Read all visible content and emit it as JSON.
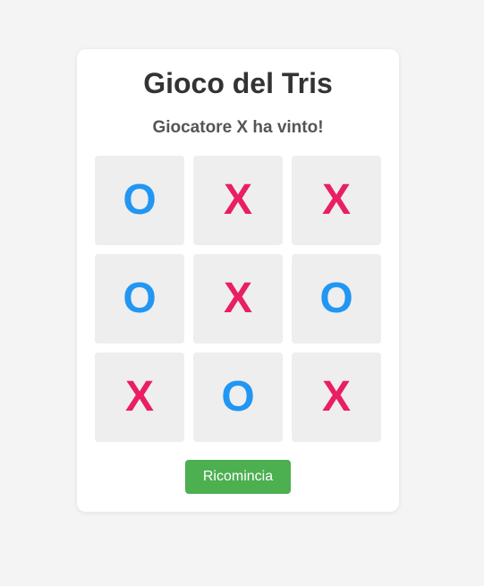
{
  "game": {
    "title": "Gioco del Tris",
    "status": "Giocatore X ha vinto!",
    "board": [
      "O",
      "X",
      "X",
      "O",
      "X",
      "O",
      "X",
      "O",
      "X"
    ],
    "restart_label": "Ricomincia"
  },
  "colors": {
    "x_mark": "#e91e63",
    "o_mark": "#2196f3",
    "restart_button": "#4caf50",
    "cell_background": "#eeeeee"
  }
}
